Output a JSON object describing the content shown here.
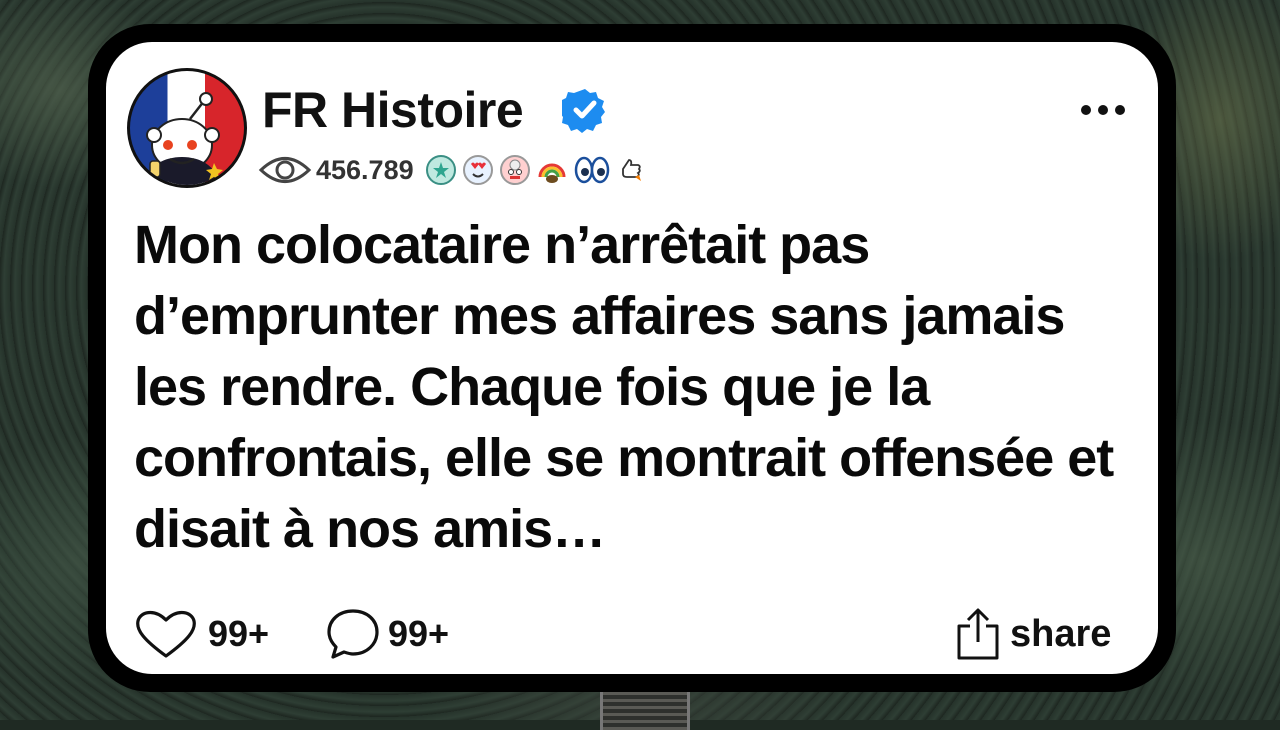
{
  "post": {
    "author": "FR Histoire",
    "views": "456.789",
    "title": "Mon colocataire n’arrêtait pas d’emprunter mes affaires sans jamais les rendre. Chaque fois que je la confrontais, elle se montrait offensée et disait à nos amis…",
    "awards": [
      "helper-award-icon",
      "love-eyes-award-icon",
      "mindblown-award-icon",
      "rainbow-gold-award-icon",
      "eyes-award-icon",
      "thumbs-up-rocket-award-icon"
    ]
  },
  "footer": {
    "likes": "99+",
    "comments": "99+",
    "share_label": "share"
  },
  "colors": {
    "verified": "#1d8cf0",
    "card_border": "#000000",
    "card_bg": "#ffffff"
  }
}
